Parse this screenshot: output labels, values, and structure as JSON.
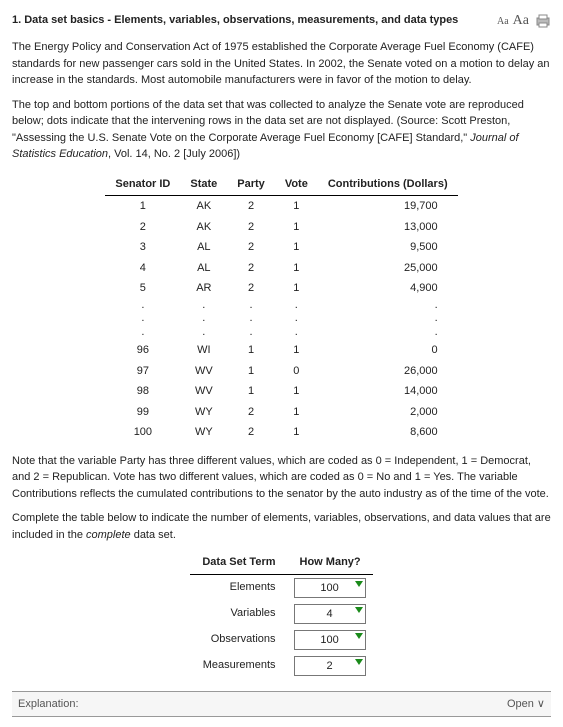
{
  "header": {
    "title": "1.  Data set basics - Elements, variables, observations, measurements, and data types"
  },
  "paragraphs": {
    "p1": "The Energy Policy and Conservation Act of 1975 established the Corporate Average Fuel Economy (CAFE) standards for new passenger cars sold in the United States. In 2002, the Senate voted on a motion to delay an increase in the standards. Most automobile manufacturers were in favor of the motion to delay.",
    "p2a": "The top and bottom portions of the data set that was collected to analyze the Senate vote are reproduced below; dots indicate that the intervening rows in the data set are not displayed. (Source: Scott Preston, \"Assessing the U.S. Senate Vote on the Corporate Average Fuel Economy [CAFE] Standard,\" ",
    "p2b": "Journal of Statistics Education",
    "p2c": ", Vol. 14, No. 2 [July 2006])",
    "p3": "Note that the variable Party has three different values, which are coded as 0 = Independent, 1 = Democrat, and 2 = Republican. Vote has two different values, which are coded as 0 = No and 1 = Yes. The variable Contributions reflects the cumulated contributions to the senator by the auto industry as of the time of the vote.",
    "p4a": "Complete the table below to indicate the number of elements, variables, observations, and data values that are included in the ",
    "p4b": "complete",
    "p4c": " data set."
  },
  "table": {
    "headers": [
      "Senator ID",
      "State",
      "Party",
      "Vote",
      "Contributions (Dollars)"
    ],
    "rows_top": [
      {
        "id": "1",
        "state": "AK",
        "party": "2",
        "vote": "1",
        "contrib": "19,700"
      },
      {
        "id": "2",
        "state": "AK",
        "party": "2",
        "vote": "1",
        "contrib": "13,000"
      },
      {
        "id": "3",
        "state": "AL",
        "party": "2",
        "vote": "1",
        "contrib": "9,500"
      },
      {
        "id": "4",
        "state": "AL",
        "party": "2",
        "vote": "1",
        "contrib": "25,000"
      },
      {
        "id": "5",
        "state": "AR",
        "party": "2",
        "vote": "1",
        "contrib": "4,900"
      }
    ],
    "rows_bottom": [
      {
        "id": "96",
        "state": "WI",
        "party": "1",
        "vote": "1",
        "contrib": "0"
      },
      {
        "id": "97",
        "state": "WV",
        "party": "1",
        "vote": "0",
        "contrib": "26,000"
      },
      {
        "id": "98",
        "state": "WV",
        "party": "1",
        "vote": "1",
        "contrib": "14,000"
      },
      {
        "id": "99",
        "state": "WY",
        "party": "2",
        "vote": "1",
        "contrib": "2,000"
      },
      {
        "id": "100",
        "state": "WY",
        "party": "2",
        "vote": "1",
        "contrib": "8,600"
      }
    ]
  },
  "answer_table": {
    "headers": [
      "Data Set Term",
      "How Many?"
    ],
    "rows": [
      {
        "term": "Elements",
        "val": "100"
      },
      {
        "term": "Variables",
        "val": "4"
      },
      {
        "term": "Observations",
        "val": "100"
      },
      {
        "term": "Measurements",
        "val": "2"
      }
    ]
  },
  "explain": {
    "label": "Explanation:",
    "open": "Open  ∨"
  }
}
